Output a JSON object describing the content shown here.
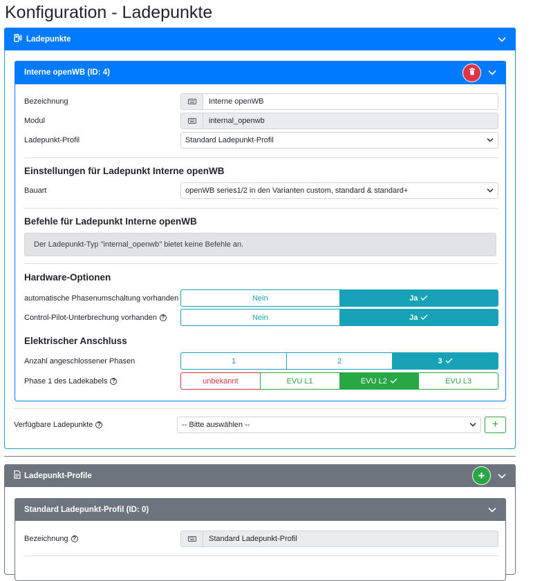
{
  "page": {
    "title": "Konfiguration - Ladepunkte"
  },
  "ladepunkte_card": {
    "title": "Ladepunkte",
    "icon": "ev-charger-icon",
    "chargepoint": {
      "title": "Interne openWB (ID: 4)",
      "fields": {
        "bezeichnung_label": "Bezeichnung",
        "bezeichnung_value": "Interne openWB",
        "modul_label": "Modul",
        "modul_value": "internal_openwb",
        "profil_label": "Ladepunkt-Profil",
        "profil_value": "Standard Ladepunkt-Profil"
      },
      "settings": {
        "title": "Einstellungen für Ladepunkt Interne openWB",
        "bauart_label": "Bauart",
        "bauart_value": "openWB series1/2 in den Varianten custom, standard & standard+"
      },
      "commands": {
        "title": "Befehle für Ladepunkt Interne openWB",
        "info": "Der Ladepunkt-Typ \"internal_openwb\" bietet keine Befehle an."
      },
      "hardware": {
        "title": "Hardware-Optionen",
        "phase_switch_label": "automatische Phasenumschaltung vorhanden",
        "cp_interrupt_label": "Control-Pilot-Unterbrechung vorhanden",
        "no_label": "Nein",
        "yes_label": "Ja"
      },
      "electrical": {
        "title": "Elektrischer Anschluss",
        "phases_label": "Anzahl angeschlossener Phasen",
        "phases_options": [
          "1",
          "2",
          "3"
        ],
        "phase1_label": "Phase 1 des Ladekabels",
        "phase1_options": [
          "unbekannt",
          "EVU L1",
          "EVU L2",
          "EVU L3"
        ]
      }
    },
    "available": {
      "label": "Verfügbare Ladepunkte",
      "placeholder": "-- Bitte auswählen --"
    }
  },
  "profile_card": {
    "title": "Ladepunkt-Profile",
    "inner_title": "Standard Ladepunkt-Profil (ID: 0)",
    "bezeichnung_label": "Bezeichnung",
    "bezeichnung_value": "Standard Ladepunkt-Profil"
  },
  "colors": {
    "primary": "#007bff",
    "info": "#17a2b8",
    "success": "#28a745",
    "danger": "#dc3545",
    "secondary": "#6c757d"
  }
}
